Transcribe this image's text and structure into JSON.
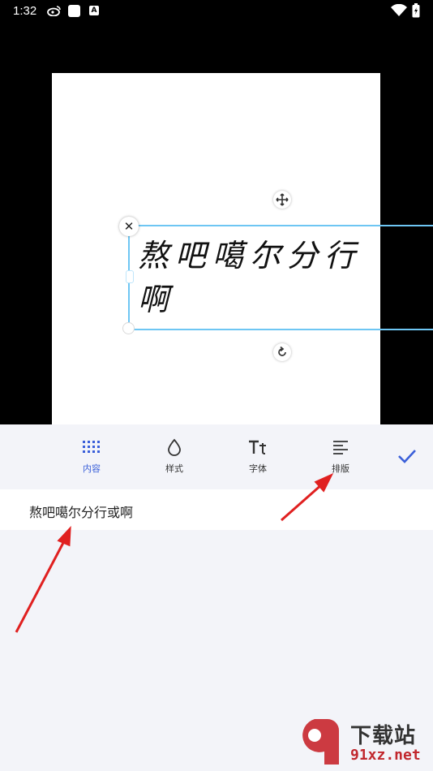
{
  "status_bar": {
    "time": "1:32",
    "icons": [
      "weibo-icon",
      "app-square-icon",
      "a-badge-icon",
      "wifi-icon",
      "battery-charging-icon"
    ],
    "a_badge": "A"
  },
  "canvas": {
    "text_content": "熬吧噶尔分行啊"
  },
  "toolbar": {
    "items": [
      {
        "label": "内容",
        "icon": "grid-dots-icon",
        "active": true
      },
      {
        "label": "样式",
        "icon": "drop-icon",
        "active": false
      },
      {
        "label": "字体",
        "icon": "text-size-icon",
        "active": false
      },
      {
        "label": "排版",
        "icon": "align-left-icon",
        "active": false
      }
    ],
    "confirm_icon": "check-icon",
    "active_color": "#3a5fd9"
  },
  "input": {
    "value": "熬吧噶尔分行或啊"
  },
  "watermark": {
    "title": "下载站",
    "url": "91xz.net"
  },
  "colors": {
    "selection": "#6ec6f3",
    "arrow": "#e02020"
  }
}
